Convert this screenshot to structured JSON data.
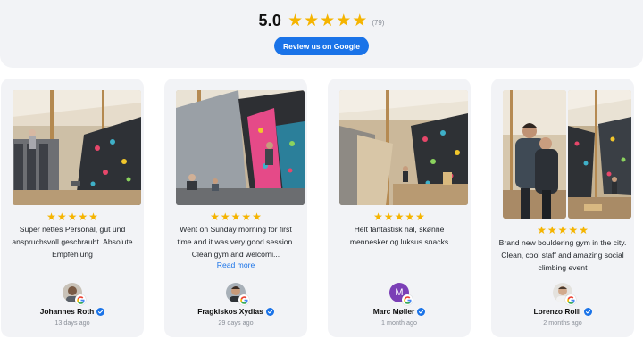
{
  "summary": {
    "rating": "5.0",
    "stars": 5,
    "count": "(79)",
    "cta_label": "Review us on Google"
  },
  "colors": {
    "star": "#f5b400",
    "cta": "#1a73e8",
    "verified": "#1a73e8",
    "card_bg": "#f2f3f6"
  },
  "reviews": [
    {
      "text": "Super nettes Personal, gut und anspruchsvoll geschraubt. Absolute Empfehlung",
      "read_more": "",
      "name": "Johannes Roth",
      "date": "13 days ago",
      "avatar": "photo",
      "stars": 5
    },
    {
      "text": "Went on Sunday morning for first time and it was very good session. Clean gym and welcomi...",
      "read_more": "Read more",
      "name": "Fragkiskos Xydias",
      "date": "29 days ago",
      "avatar": "photo",
      "stars": 5
    },
    {
      "text": "Helt fantastisk hal, skønne mennesker og luksus snacks",
      "read_more": "",
      "name": "Marc Møller",
      "date": "1 month ago",
      "avatar_letter": "M",
      "stars": 5
    },
    {
      "text": "Brand new bouldering gym in the city. Clean, cool staff and amazing social climbing event",
      "read_more": "",
      "name": "Lorenzo Rolli",
      "date": "2 months ago",
      "avatar": "photo",
      "stars": 5
    }
  ]
}
